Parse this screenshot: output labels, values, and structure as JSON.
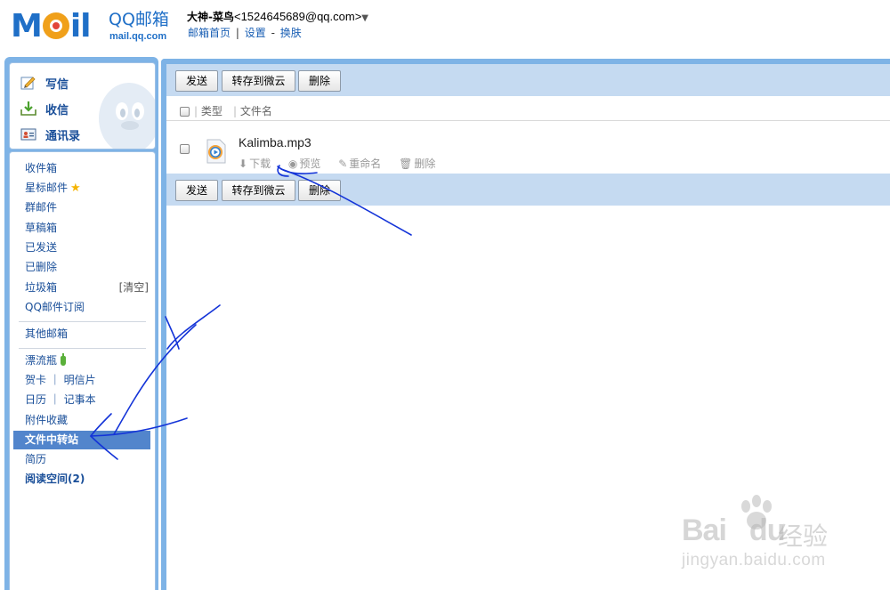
{
  "header": {
    "logo_word": "M",
    "logo_word_tail": "il",
    "brand_name": "QQ邮箱",
    "brand_url": "mail.qq.com",
    "user_nickname": "大神-菜鸟",
    "user_email": "<1524645689@qq.com>",
    "user_caret": "▼",
    "links": [
      "邮箱首页",
      "设置",
      "换肤"
    ],
    "link_separators": [
      "|",
      "-"
    ]
  },
  "quick_actions": [
    {
      "label": "写信",
      "icon": "write-icon"
    },
    {
      "label": "收信",
      "icon": "receive-icon"
    },
    {
      "label": "通讯录",
      "icon": "contacts-icon"
    }
  ],
  "folders": [
    {
      "label": "收件箱"
    },
    {
      "label": "星标邮件",
      "icon": "star-icon"
    },
    {
      "label": "群邮件"
    },
    {
      "label": "草稿箱"
    },
    {
      "label": "已发送"
    },
    {
      "label": "已删除"
    },
    {
      "label": "垃圾箱",
      "extra": "[清空]"
    },
    {
      "label": "QQ邮件订阅"
    }
  ],
  "other_mailbox": {
    "label": "其他邮箱"
  },
  "apps": [
    {
      "label": "漂流瓶",
      "icon": "bottle-icon"
    },
    {
      "label": "贺卡 ｜ 明信片"
    },
    {
      "label": "日历 ｜ 记事本"
    },
    {
      "label": "附件收藏"
    },
    {
      "label": "文件中转站",
      "selected": true
    },
    {
      "label": "简历"
    },
    {
      "label": "阅读空间(2)",
      "bold": true
    }
  ],
  "toolbar": {
    "send_label": "发送",
    "save_label": "转存到微云",
    "delete_label": "删除"
  },
  "columns": {
    "separator": "|",
    "type_label": "类型",
    "name_label": "文件名"
  },
  "file": {
    "name": "Kalimba.mp3",
    "icon": "media-file-icon",
    "actions": [
      {
        "label": "下载",
        "icon": "download-icon"
      },
      {
        "label": "预览",
        "icon": "eye-icon"
      },
      {
        "label": "重命名",
        "icon": "pencil-icon"
      },
      {
        "label": "删除",
        "icon": "trash-icon"
      }
    ]
  },
  "watermark": {
    "brand": "Bai",
    "brand_tail": "du",
    "product": "经验",
    "url": "jingyan.baidu.com"
  },
  "colors": {
    "brand_blue": "#1f6fc7",
    "panel_blue": "#7eb3e6",
    "toolbar_blue": "#c5daf1",
    "selected_blue": "#5285cc",
    "annotation_ink": "#1434d8"
  }
}
